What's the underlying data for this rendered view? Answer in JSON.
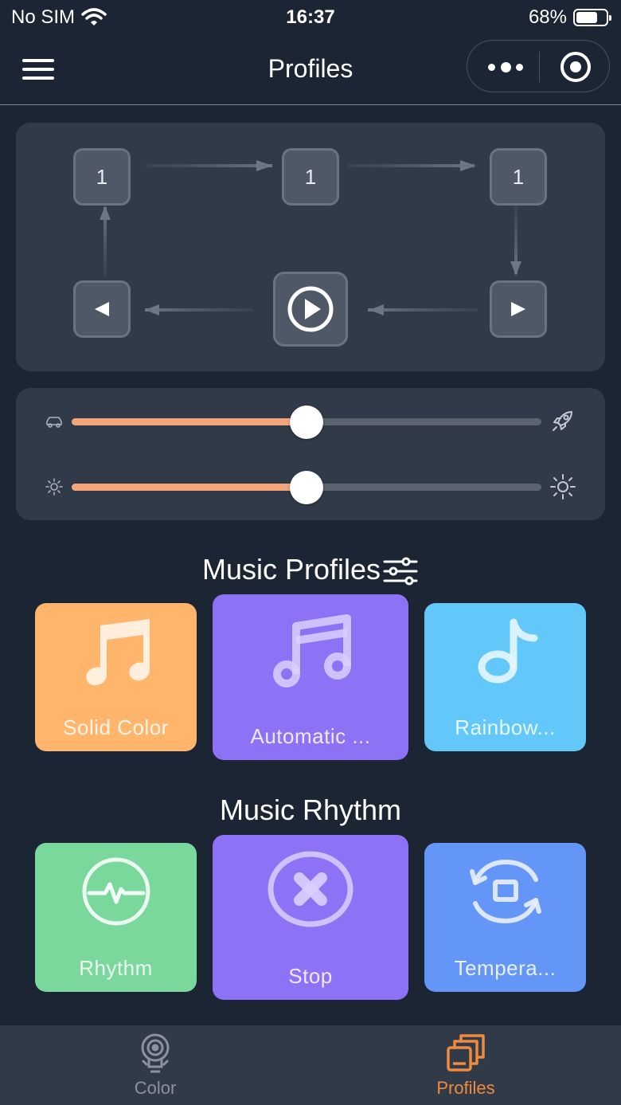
{
  "status_bar": {
    "carrier": "No SIM",
    "time": "16:37",
    "battery": "68%"
  },
  "nav": {
    "title": "Profiles"
  },
  "loop_panel": {
    "key_1": "1",
    "key_2": "1",
    "key_3": "1"
  },
  "sliders": {
    "speed_value": 0.5,
    "brightness_value": 0.5,
    "track_fill_color": "#f5a57a",
    "track_color": "#5b636f"
  },
  "music_profiles": {
    "title": "Music Profiles",
    "cards": [
      {
        "label": "Solid Color",
        "color": "#ffb56b",
        "icon": "music-notes-icon"
      },
      {
        "label": "Automatic ...",
        "color": "#8e72f5",
        "icon": "music-notes-icon"
      },
      {
        "label": "Rainbow...",
        "color": "#62c8fa",
        "icon": "music-note-icon"
      }
    ]
  },
  "music_rhythm": {
    "title": "Music Rhythm",
    "cards": [
      {
        "label": "Rhythm",
        "color": "#7ad89c",
        "icon": "pulse-icon"
      },
      {
        "label": "Stop",
        "color": "#8e72f5",
        "icon": "stop-icon"
      },
      {
        "label": "Tempera...",
        "color": "#6496f7",
        "icon": "cycle-icon"
      }
    ]
  },
  "tab_bar": {
    "tabs": [
      {
        "label": "Color",
        "color": "#8b929c"
      },
      {
        "label": "Profiles",
        "color": "#f08a3c"
      }
    ]
  }
}
